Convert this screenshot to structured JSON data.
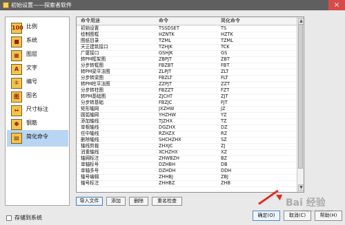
{
  "window": {
    "title": "初始设置——探索者软件"
  },
  "sidebar": {
    "items": [
      {
        "label": "比例"
      },
      {
        "label": "系统"
      },
      {
        "label": "图层"
      },
      {
        "label": "文字"
      },
      {
        "label": "编号"
      },
      {
        "label": "图名"
      },
      {
        "label": "尺寸标注"
      },
      {
        "label": "钢筋"
      },
      {
        "label": "简化命令"
      }
    ]
  },
  "table": {
    "headers": [
      "命令用途",
      "命令",
      "简化命令"
    ],
    "rows": [
      [
        "初始设置",
        "TSSDSET",
        "TS"
      ],
      [
        "绘制图框",
        "HZNTK",
        "HZTK"
      ],
      [
        "图纸目录",
        "TZML",
        "TZML"
      ],
      [
        "天正建筑接口",
        "TZHJK",
        "TCK"
      ],
      [
        "广厦接口",
        "GSHJK",
        "GS"
      ],
      [
        "转PM框架图",
        "ZBPJT",
        "ZBT"
      ],
      [
        "分步转框图",
        "FBZBT",
        "FBT"
      ],
      [
        "转PM梁平法图",
        "ZLPJT",
        "ZLT"
      ],
      [
        "分步转梁图",
        "FBZLT",
        "FLT"
      ],
      [
        "转PM柱平法图",
        "ZZPJT",
        "ZZT"
      ],
      [
        "分步转柱图",
        "FBZZT",
        "FZT"
      ],
      [
        "转PM基础图",
        "ZJCHT",
        "ZJT"
      ],
      [
        "分步转基础",
        "FBZJC",
        "FJT"
      ],
      [
        "矩形轴网",
        "JXZHW",
        "JZ"
      ],
      [
        "圆弧轴网",
        "YHZHW",
        "YZ"
      ],
      [
        "添加轴线",
        "TJZHX",
        "TZ"
      ],
      [
        "单根轴线",
        "DGZHX",
        "DZ"
      ],
      [
        "任中轴线",
        "RZHZX",
        "RZ"
      ],
      [
        "删除轴线",
        "SHCHZHX",
        "SZ"
      ],
      [
        "轴线剪裁",
        "ZHXJC",
        "ZJ"
      ],
      [
        "消重轴线",
        "XCHZHX",
        "XZ"
      ],
      [
        "轴网标注",
        "ZHWBZH",
        "BZ"
      ],
      [
        "单轴标号",
        "DZHBH",
        "DB"
      ],
      [
        "单轴多号",
        "DZHDH",
        "DDH"
      ],
      [
        "轴号编辑",
        "ZHHBJ",
        "ZBJ"
      ],
      [
        "轴号标注",
        "ZHHBZ",
        "ZHB"
      ]
    ]
  },
  "buttons": {
    "import": "导入文件",
    "add": "添加",
    "delete": "删除",
    "rename": "重名检查",
    "save_system_label": "存储到系统",
    "ok": "确定(O)",
    "cancel": "取消(C)",
    "help": "帮助(H)"
  },
  "watermark": {
    "main": "Bai 经验",
    "sub": "jingyan.baidu.com"
  },
  "colors": {
    "active_sidebar": "#b9d5f4",
    "accent_arrow": "#e22c23"
  }
}
